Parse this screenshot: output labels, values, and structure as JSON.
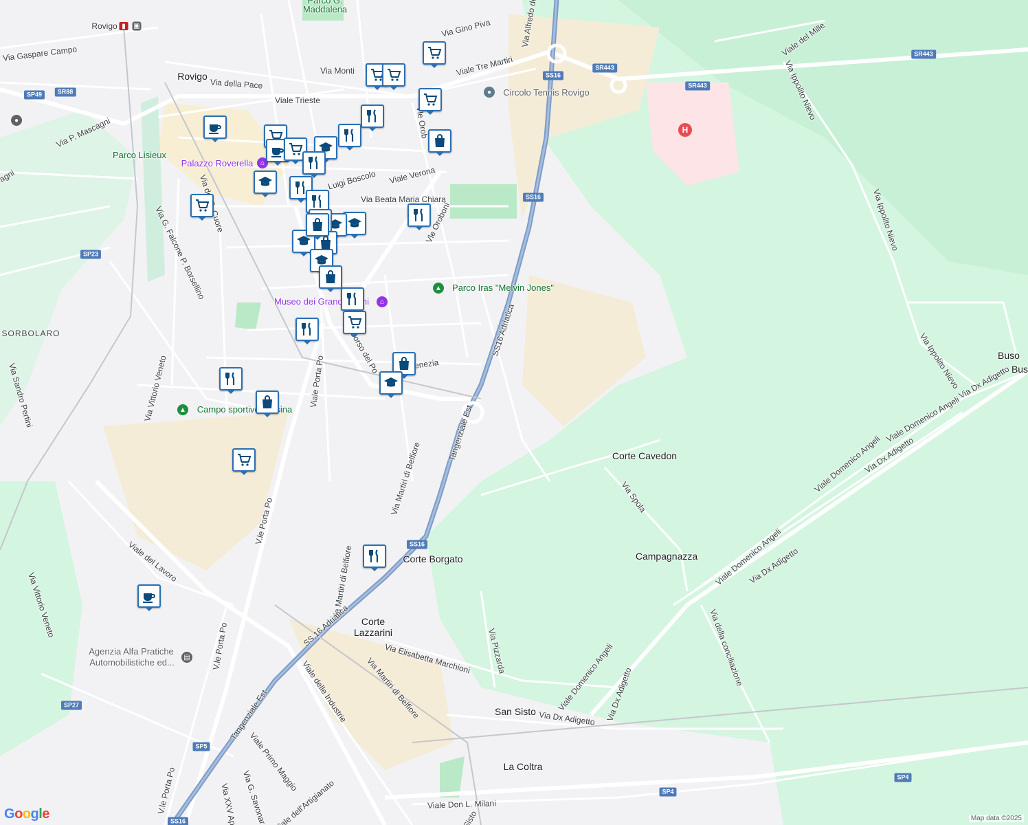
{
  "map": {
    "attribution": "Map data ©2025",
    "logo": "Google",
    "colors": {
      "land": "#f2f2f4",
      "greenery": "#d4f5e0",
      "urban_tan": "#f5ecd7",
      "highway": "#7f9cc6",
      "road": "#ffffff",
      "marker_border": "#2a6fb3",
      "hospital": "#fde4e6"
    }
  },
  "places": {
    "rovigo": "Rovigo",
    "sorbolaro": "SORBOLARO",
    "corte_cavedon": "Corte Cavedon",
    "campagnazza": "Campagnazza",
    "corte_borgato": "Corte Borgato",
    "corte_lazzarini_1": "Corte",
    "corte_lazzarini_2": "Lazzarini",
    "san_sisto": "San Sisto",
    "la_coltra": "La Coltra",
    "buso": "Buso",
    "buso2": "Bus"
  },
  "pois": {
    "parco_maddalena_1": "Parco G.",
    "parco_maddalena_2": "Maddalena",
    "circolo_tennis": "Circolo Tennis Rovigo",
    "parco_lisieux": "Parco Lisieux",
    "palazzo_roverella": "Palazzo Roverella",
    "parco_iras": "Parco Iras \"Melvin Jones\"",
    "museo": "Museo dei Grandi Fiumi",
    "campo_sportivo": "Campo sportivo Tassina",
    "agenzia_1": "Agenzia Alfa Pratiche",
    "agenzia_2": "Automobilistiche ed..."
  },
  "roads": {
    "via_gaspare_campo": "Via Gaspare Campo",
    "viale_trieste": "Viale Trieste",
    "via_della_pace": "Via della Pace",
    "via_monti": "Via Monti",
    "viale_tre_martiri": "Viale Tre Martiri",
    "via_gino_piva": "Via Gino Piva",
    "via_alfredo": "Via Alfredo de",
    "via_p_mascagni": "Via P. Mascagni",
    "viale_verona": "Viale Verona",
    "via_luigi_boscolo": "Luigi Boscolo",
    "via_beata_maria_chiara": "Via Beata Maria Chiara",
    "vle_oroboni_1": "Vle Orob",
    "vle_oroboni_2": "Vle Oroboni",
    "viale_del_mille": "Viale del Mille",
    "via_ippolito_nievo": "Via Ippolito Nievo",
    "via_ippolito_nievo_2": "Via Ippolito Nievo",
    "via_ippolito_nievo_3": "Via Ippolito Nievo",
    "via_sacro_cuore": "Via del S. Cuore",
    "via_falcone": "Via G. Falcone P. Borsellino",
    "ss16_adriatica": "SS16 Adriatica",
    "tangenziale_est": "Tangenziale Est",
    "corso_del_po": "Corso del Po",
    "viale_porta_po_1": "Viale Porta Po",
    "via_venezia": "Venezia",
    "via_sandro_pertini": "Via Sandro Pertini",
    "via_vittorio_veneto": "Via Vittorio Veneto",
    "via_martiri_belfiore": "Via Martiri di Belfiore",
    "via_martiri_belfiore_2": "Via Martiri di Belfiore",
    "via_martiri_belfiore_3": "Via Martiri di Belfiore",
    "viale_domenico_angeli_1": "Viale Domenico Angeli",
    "viale_domenico_angeli_2": "Viale Domenico Angeli",
    "viale_domenico_angeli_3": "Viale Domenico Angeli",
    "viale_domenico_angeli_4": "Viale Domenico Angeli",
    "via_dx_adigetto_1": "Via Dx Adigetto",
    "via_dx_adigetto_2": "Via Dx Adigetto",
    "via_dx_adigetto_3": "Via Dx Adigetto",
    "via_dx_adigetto_4": "Via Dx Adigetto",
    "via_dx_adigetto_5": "Via Dx Adigetto",
    "via_spola": "Via Spola",
    "viale_del_lavoro": "Viale del Lavoro",
    "via_vittorio_veneto_2": "Via Vittorio Veneto",
    "vle_porta_po_2": "V.le Porta Po",
    "vle_porta_po_3": "V.le Porta Po",
    "vle_porta_po_4": "V.le Porta Po",
    "ss16_adriatica_2": "SS.16 Adriatica",
    "tangenziale_est_2": "Tangenziale Est",
    "viale_delle_industrie": "Viale delle Industrie",
    "via_elisabetta_marchioni": "Via Elisabetta Marchioni",
    "via_pizzarda": "Via Pizzarda",
    "via_della_conciliazione": "Via della conciliazione",
    "viale_primo_maggio": "Viale Primo Maggio",
    "via_g_savonarola": "Via G. Savonar",
    "via_xxv_aprile": "Via XXV Apr",
    "viale_artigianato": "Viale dell'Artigianato",
    "viale_don_milani": "Viale Don L. Milani",
    "via_sisto": "Sisto",
    "via_magni": "agni"
  },
  "shields": {
    "ss16_a": "SS16",
    "ss16_b": "SS16",
    "ss16_c": "SS16",
    "ss16_d": "SS16",
    "sr443_a": "SR443",
    "sr443_b": "SR443",
    "sr443_c": "SR443",
    "sp49": "SP49",
    "sr88": "SR88",
    "sp23": "SP23",
    "sp27": "SP27",
    "sp5": "SP5",
    "sp4_a": "SP4",
    "sp4_b": "SP4"
  },
  "markers": [
    {
      "type": "shopping-cart-icon"
    },
    {
      "type": "shopping-cart-icon"
    },
    {
      "type": "shopping-cart-icon"
    },
    {
      "type": "shopping-cart-icon"
    },
    {
      "type": "restaurant-icon"
    },
    {
      "type": "restaurant-icon"
    },
    {
      "type": "shopping-bag-icon"
    },
    {
      "type": "cafe-icon"
    },
    {
      "type": "shopping-cart-icon"
    },
    {
      "type": "cafe-icon"
    },
    {
      "type": "shopping-cart-icon"
    },
    {
      "type": "school-icon"
    },
    {
      "type": "restaurant-icon"
    },
    {
      "type": "school-icon"
    },
    {
      "type": "restaurant-icon"
    },
    {
      "type": "shopping-cart-icon"
    },
    {
      "type": "restaurant-icon"
    },
    {
      "type": "restaurant-icon"
    },
    {
      "type": "school-icon"
    },
    {
      "type": "school-icon"
    },
    {
      "type": "school-icon"
    },
    {
      "type": "shopping-bag-icon"
    },
    {
      "type": "school-icon"
    },
    {
      "type": "shopping-bag-icon"
    },
    {
      "type": "school-icon"
    },
    {
      "type": "restaurant-icon"
    },
    {
      "type": "shopping-cart-icon"
    },
    {
      "type": "restaurant-icon"
    },
    {
      "type": "shopping-bag-icon"
    },
    {
      "type": "shopping-bag-icon"
    },
    {
      "type": "school-icon"
    },
    {
      "type": "restaurant-icon"
    },
    {
      "type": "shopping-bag-icon"
    },
    {
      "type": "shopping-cart-icon"
    },
    {
      "type": "restaurant-icon"
    },
    {
      "type": "cafe-icon"
    }
  ]
}
